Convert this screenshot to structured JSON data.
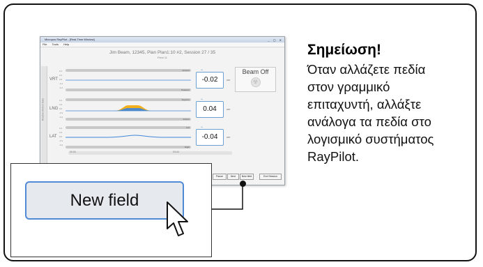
{
  "app_window": {
    "title": "Micropos RayPilot - [Real-Time Window]",
    "menu": [
      "File",
      "Tools",
      "Help"
    ],
    "patient_line": "Jim Beam, 12345, Plan Plan1:10 #2, Session 27 / 35",
    "field_line": "Field 11",
    "side_tab": "Relative Motion Data",
    "axes": [
      {
        "label": "VRT",
        "value": "-0.02",
        "unit": "cm",
        "top_tag": "Anterior",
        "bottom_tag": "Posterior",
        "scale": [
          "0.4",
          "0.2",
          "0.0",
          "-0.2",
          "-0.4"
        ]
      },
      {
        "label": "LNG",
        "value": "0.04",
        "unit": "cm",
        "top_tag": "Superior",
        "bottom_tag": "Inferior",
        "scale": [
          "0.4",
          "0.2",
          "0.0",
          "-0.2",
          "-0.4"
        ]
      },
      {
        "label": "LAT",
        "value": "-0.04",
        "unit": "cm",
        "top_tag": "Left",
        "bottom_tag": "Right",
        "scale": [
          "0.4",
          "0.2",
          "0.0",
          "-0.2",
          "-0.4"
        ]
      }
    ],
    "beam_status": "Beam Off",
    "bottom_scale": {
      "left": "00:00",
      "right": "03:44"
    },
    "buttons": [
      "Pause",
      "Next",
      "New field",
      "End Session"
    ]
  },
  "callout": {
    "button_label": "New field"
  },
  "note": {
    "title": "Σημείωση!",
    "lines": [
      "Όταν αλλάζετε πεδία",
      "στον γραμμικό",
      "επιταχυντή, αλλάξτε",
      "ανάλογα τα πεδία στο",
      "λογισμικό συστήματος",
      "RayPilot."
    ]
  },
  "colors": {
    "accent_blue": "#4f8ad6",
    "motion_orange": "#f2b01e",
    "motion_blue": "#3f86d8"
  },
  "icons": [
    "radiation-icon",
    "mouse-pointer-icon",
    "check-icon"
  ]
}
